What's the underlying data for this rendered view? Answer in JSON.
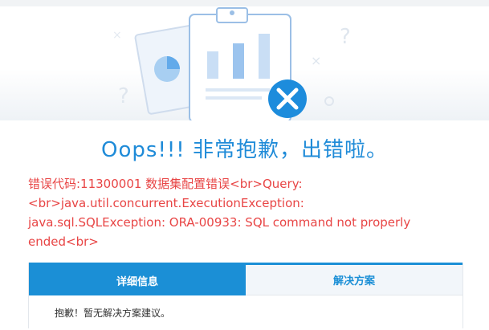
{
  "heading": "Oops!!! 非常抱歉，出错啦。",
  "error": {
    "lines": [
      "错误代码:11300001 数据集配置错误<br>Query:",
      "<br>java.util.concurrent.ExecutionException:",
      "java.sql.SQLException: ORA-00933: SQL command not properly",
      "ended<br>"
    ]
  },
  "tabs": [
    {
      "label": "详细信息",
      "active": true
    },
    {
      "label": "解决方案",
      "active": false
    }
  ],
  "tab_content": "抱歉！暂无解决方案建议。",
  "colors": {
    "accent": "#1b8fd6",
    "error_text": "#e84545",
    "title_text": "#1f8bd8"
  },
  "illustration": {
    "icons": [
      "clipboard-icon",
      "pie-chart-icon",
      "bar-chart-icon",
      "error-x-icon",
      "question-mark-icon"
    ],
    "decor_glyphs": [
      "?",
      "?",
      "×",
      "×"
    ]
  }
}
